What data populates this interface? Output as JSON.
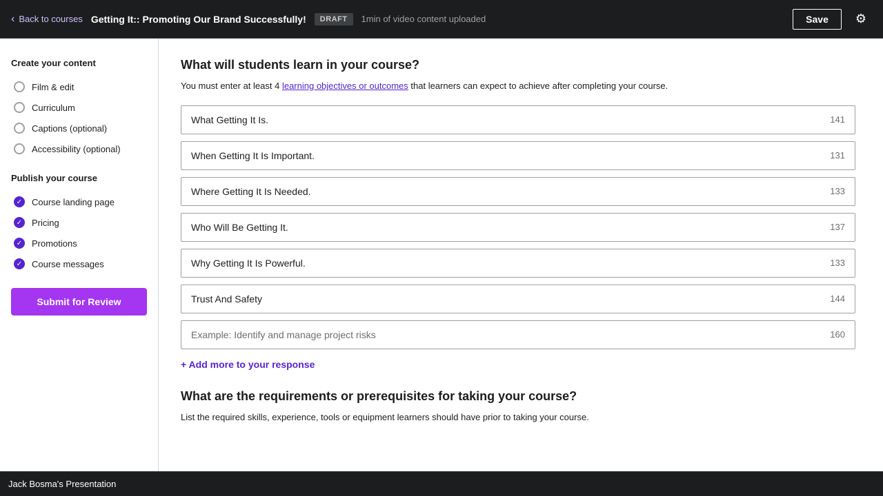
{
  "topbar": {
    "back_label": "Back to courses",
    "course_title": "Getting It:: Promoting Our Brand Successfully!",
    "draft_badge": "DRAFT",
    "upload_status": "1min of video content uploaded",
    "save_label": "Save",
    "gear_icon": "⚙"
  },
  "sidebar": {
    "create_section_title": "Create your content",
    "create_items": [
      {
        "label": "Film & edit",
        "checked": false
      },
      {
        "label": "Curriculum",
        "checked": false
      },
      {
        "label": "Captions (optional)",
        "checked": false
      },
      {
        "label": "Accessibility (optional)",
        "checked": false
      }
    ],
    "publish_section_title": "Publish your course",
    "publish_items": [
      {
        "label": "Course landing page",
        "checked": true
      },
      {
        "label": "Pricing",
        "checked": true
      },
      {
        "label": "Promotions",
        "checked": true
      },
      {
        "label": "Course messages",
        "checked": true
      }
    ],
    "submit_label": "Submit for Review"
  },
  "content": {
    "section1_heading": "What will students learn in your course?",
    "section1_desc_before": "You must enter at least 4 ",
    "section1_link": "learning objectives or outcomes",
    "section1_desc_after": " that learners can expect to achieve after completing your course.",
    "learning_items": [
      {
        "value": "What Getting It Is.",
        "char_count": "141"
      },
      {
        "value": "When Getting It Is Important.",
        "char_count": "131"
      },
      {
        "value": "Where Getting It Is Needed.",
        "char_count": "133"
      },
      {
        "value": "Who Will Be Getting It.",
        "char_count": "137"
      },
      {
        "value": "Why Getting It Is Powerful.",
        "char_count": "133"
      },
      {
        "value": "Trust And Safety",
        "char_count": "144"
      }
    ],
    "empty_input_placeholder": "Example: Identify and manage project risks",
    "empty_input_char_count": "160",
    "add_more_label": "+ Add more to your response",
    "section2_heading": "What are the requirements or prerequisites for taking your course?",
    "section2_desc": "List the required skills, experience, tools or equipment learners should have prior to taking your course."
  },
  "taskbar": {
    "label": "Jack Bosma's Presentation"
  }
}
